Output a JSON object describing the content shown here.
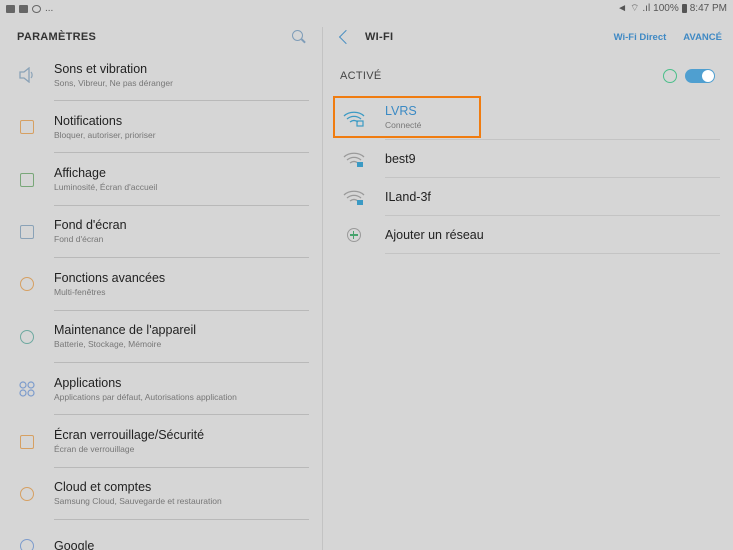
{
  "statusbar": {
    "left_extra": "...",
    "right_text": "100%",
    "time": "8:47 PM"
  },
  "left": {
    "title": "PARAMÈTRES",
    "items": [
      {
        "title": "Sons et vibration",
        "subtitle": "Sons, Vibreur, Ne pas déranger",
        "icon": "speaker-icon"
      },
      {
        "title": "Notifications",
        "subtitle": "Bloquer, autoriser, prioriser",
        "icon": "notification-icon"
      },
      {
        "title": "Affichage",
        "subtitle": "Luminosité, Écran d'accueil",
        "icon": "display-icon"
      },
      {
        "title": "Fond d'écran",
        "subtitle": "Fond d'écran",
        "icon": "wallpaper-icon"
      },
      {
        "title": "Fonctions avancées",
        "subtitle": "Multi-fenêtres",
        "icon": "gear-icon"
      },
      {
        "title": "Maintenance de l'appareil",
        "subtitle": "Batterie, Stockage, Mémoire",
        "icon": "maintenance-icon"
      },
      {
        "title": "Applications",
        "subtitle": "Applications par défaut, Autorisations application",
        "icon": "apps-icon"
      },
      {
        "title": "Écran verrouillage/Sécurité",
        "subtitle": "Écran de verrouillage",
        "icon": "lock-icon"
      },
      {
        "title": "Cloud et comptes",
        "subtitle": "Samsung Cloud, Sauvegarde et restauration",
        "icon": "key-icon"
      },
      {
        "title": "Google",
        "subtitle": "",
        "icon": "google-icon"
      }
    ]
  },
  "right": {
    "title": "WI-FI",
    "wifi_direct": "Wi-Fi Direct",
    "advanced": "AVANCÉ",
    "active_label": "ACTIVÉ",
    "networks": [
      {
        "name": "LVRS",
        "status": "Connecté"
      },
      {
        "name": "best9",
        "status": ""
      },
      {
        "name": "ILand-3f",
        "status": ""
      }
    ],
    "add_network": "Ajouter un réseau"
  },
  "colors": {
    "accent": "#3f89c4",
    "highlight": "#f07c10",
    "switch": "#4f9fd0"
  }
}
